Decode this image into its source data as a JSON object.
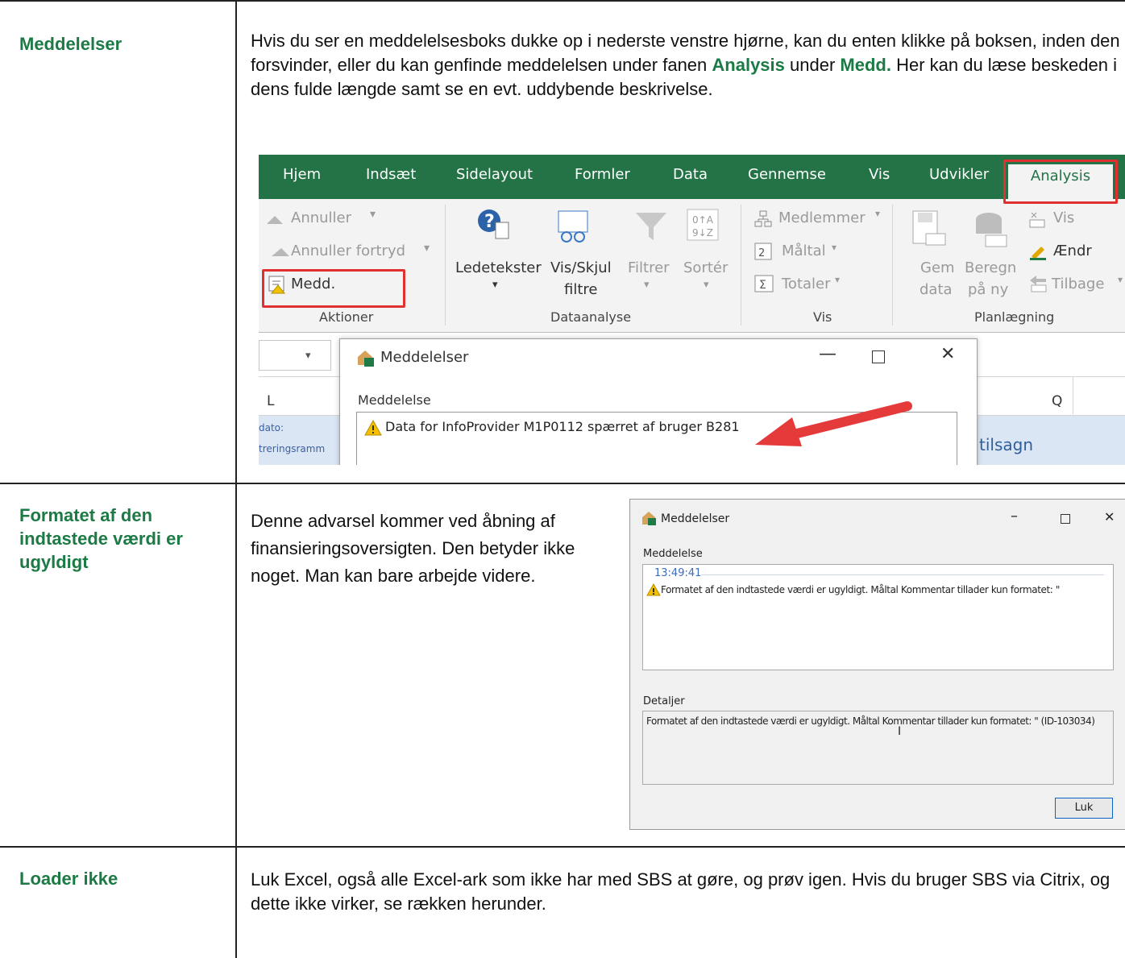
{
  "rows": [
    {
      "label": "Meddelelser",
      "text_parts": [
        "Hvis du ser en meddelelsesboks dukke op i nederste venstre hjørne, kan du enten klikke på boksen, inden den forsvinder, eller du kan genfinde meddelelsen under fanen ",
        "Analysis",
        " under ",
        "Medd.",
        " Her kan du læse beskeden i dens fulde længde samt se en evt. uddybende beskrivelse."
      ]
    },
    {
      "label": "Formatet af den indtastede værdi er ugyldigt",
      "text": "Denne advarsel kommer ved åbning af finansieringsoversigten. Den betyder ikke noget. Man kan bare arbejde videre."
    },
    {
      "label": "Loader ikke",
      "text": "Luk Excel, også alle Excel-ark som ikke har med SBS at gøre, og prøv igen. Hvis du bruger SBS via Citrix, og dette ikke virker, se rækken herunder."
    }
  ],
  "ribbon": {
    "tabs": [
      "Hjem",
      "Indsæt",
      "Sidelayout",
      "Formler",
      "Data",
      "Gennemse",
      "Vis",
      "Udvikler",
      "Analysis"
    ],
    "active_tab": "Analysis",
    "aktioner": {
      "undo": "Annuller",
      "redo": "Annuller fortryd",
      "medd": "Medd.",
      "group": "Aktioner"
    },
    "dataanalyse": {
      "ledetekster": "Ledetekster",
      "vis_skjul": "Vis/Skjul",
      "filtre": "filtre",
      "filtrer": "Filtrer",
      "sorter": "Sortér",
      "group": "Dataanalyse"
    },
    "vis": {
      "medlemmer": "Medlemmer",
      "maaltal": "Måltal",
      "totaler": "Totaler",
      "group": "Vis"
    },
    "planlaegning": {
      "gem": "Gem",
      "data": "data",
      "beregn": "Beregn",
      "paa_ny": "på ny",
      "vis": "Vis",
      "aendr": "Ændr",
      "tilbage": "Tilbage",
      "group": "Planlægning"
    },
    "columns": [
      "L",
      "Q"
    ],
    "cells": [
      "dato:",
      "treringsramm",
      "tilsagn"
    ],
    "dialog": {
      "title": "Meddelelser",
      "section": "Meddelelse",
      "message": "Data for InfoProvider M1P0112 spærret af bruger B281"
    }
  },
  "dialog2": {
    "title": "Meddelelser",
    "section": "Meddelelse",
    "time": "13:49:41",
    "message": "Formatet af den indtastede værdi  er ugyldigt. Måltal Kommentar tillader kun formatet: \"",
    "details_label": "Detaljer",
    "details": "Formatet af den indtastede værdi  er ugyldigt. Måltal Kommentar tillader kun formatet: \" (ID-103034)",
    "close_button": "Luk"
  },
  "colors": {
    "heading_green": "#1c7a45",
    "excel_green": "#237346",
    "highlight_red": "#e03030"
  }
}
